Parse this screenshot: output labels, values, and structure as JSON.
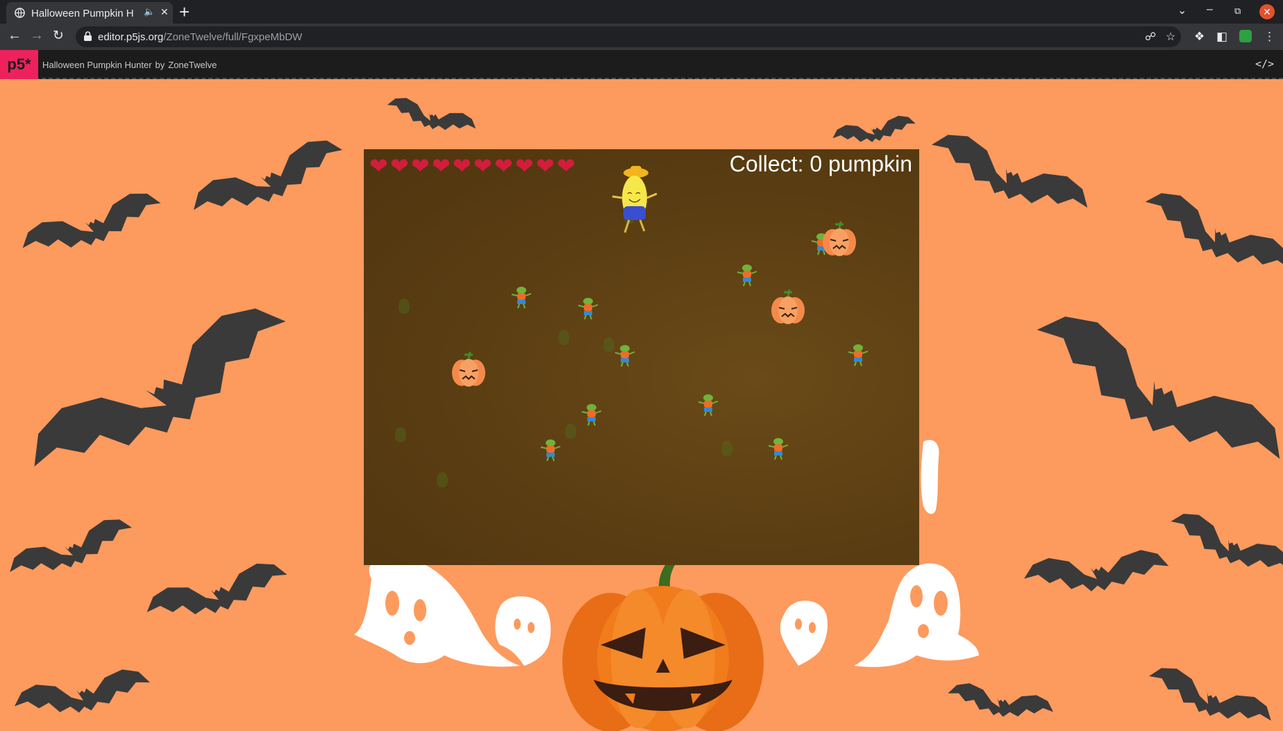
{
  "browser": {
    "tab_title": "Halloween Pumpkin H",
    "url_host": "editor.p5js.org",
    "url_path": "/ZoneTwelve/full/FgxpeMbDW"
  },
  "p5_header": {
    "logo": "p5*",
    "sketch_title": "Halloween Pumpkin Hunter",
    "by_label": "by",
    "author": "ZoneTwelve"
  },
  "game": {
    "collect_text": "Collect: 0 pumpkin",
    "hearts_count": 10,
    "player": "banana-farmer",
    "enemies_count": 11,
    "pumpkins_count": 3
  },
  "colors": {
    "background": "#fd9a5e",
    "bat": "#3a3a3a",
    "canvas": "#5a3d12",
    "heart": "#d21d3c",
    "p5_brand": "#ed225d"
  }
}
